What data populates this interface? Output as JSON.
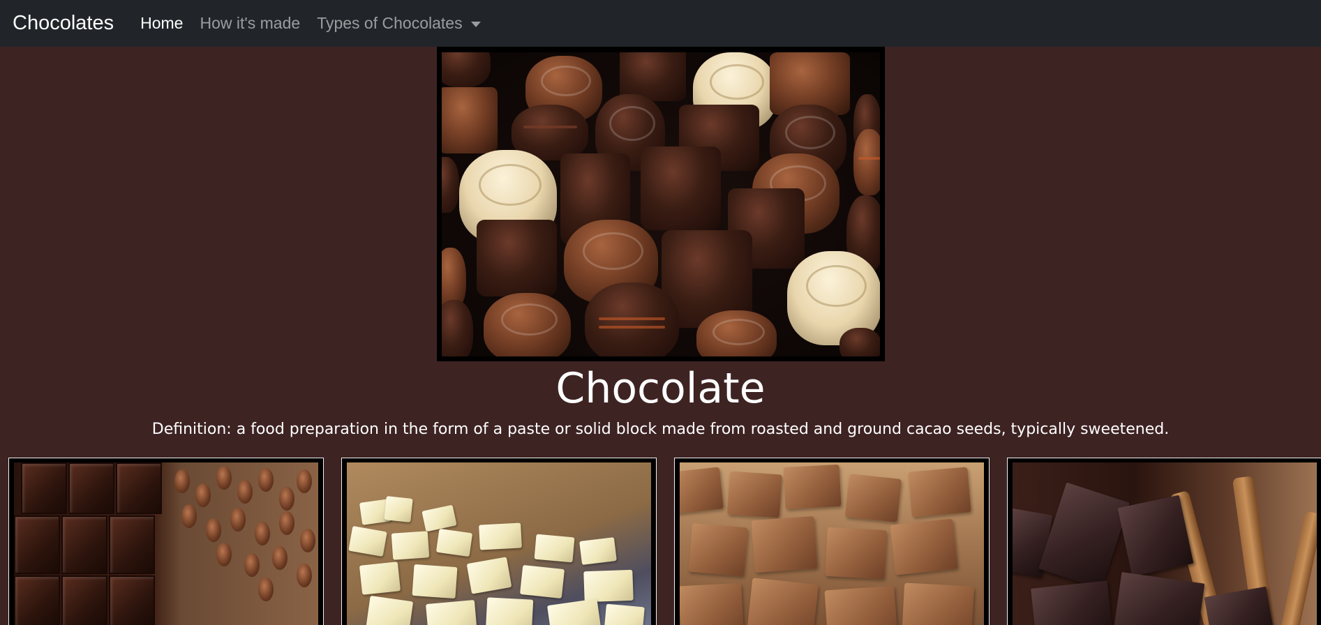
{
  "navbar": {
    "brand": "Chocolates",
    "links": [
      {
        "label": "Home",
        "active": true
      },
      {
        "label": "How it's made",
        "active": false
      },
      {
        "label": "Types of Chocolates",
        "active": false,
        "dropdown": true
      }
    ]
  },
  "hero": {
    "image_icon": "assorted-chocolates-image"
  },
  "main": {
    "title": "Chocolate",
    "definition": "Definition: a food preparation in the form of a paste or solid block made from roasted and ground cacao seeds, typically sweetened."
  },
  "cards": [
    {
      "image": "dark-chocolate-bar-with-cocoa-beans"
    },
    {
      "image": "white-chocolate-chunks"
    },
    {
      "image": "milk-chocolate-chunks"
    },
    {
      "image": "dark-chocolate-chunks-with-cinnamon"
    }
  ],
  "colors": {
    "page_background": "#3e2323",
    "navbar_background": "#212529",
    "text": "#ffffff",
    "nav_link_inactive": "rgba(255,255,255,0.55)"
  }
}
